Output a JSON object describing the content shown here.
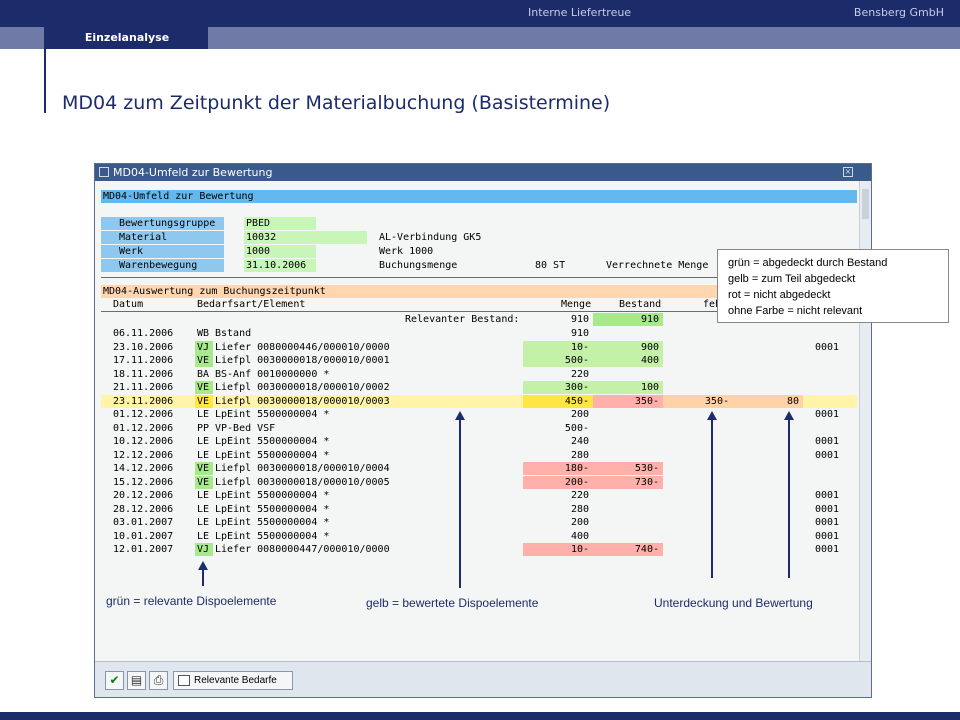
{
  "header": {
    "title": "Interne Liefertreue",
    "company": "Bensberg GmbH",
    "active_tab": "Einzelanalyse",
    "page_title": "MD04 zum Zeitpunkt der Materialbuchung (Basistermine)"
  },
  "window": {
    "title": "MD04-Umfeld zur Bewertung",
    "section1_title": "MD04-Umfeld zur Bewertung",
    "fields": [
      {
        "label": "Bewertungsgruppe",
        "value": "PBED",
        "extra": ""
      },
      {
        "label": "Material",
        "value": "10032",
        "extra": "AL-Verbindung GK5"
      },
      {
        "label": "Werk",
        "value": "1000",
        "extra": "Werk 1000"
      },
      {
        "label": "Warenbewegung",
        "value": "31.10.2006",
        "extra": "Buchungsmenge",
        "qty": "80 ST",
        "extra2": "Verrechnete Menge"
      }
    ],
    "section2_title": "MD04-Auswertung zum Buchungszeitpunkt",
    "columns": {
      "datum": "Datum",
      "element": "Bedarfsart/Element",
      "menge": "Menge",
      "bestand": "Bestand",
      "fehl": "feh"
    },
    "relevant_label": "Relevanter Bestand:",
    "relevant_menge": "910",
    "relevant_bestand": "910",
    "rows": [
      {
        "datum": "06.11.2006",
        "art": "WB",
        "element": "Bstand",
        "menge": "910",
        "bestand": "",
        "fehl": "",
        "bew": "",
        "nr": ""
      },
      {
        "datum": "23.10.2006",
        "art": "VJ",
        "element": "Liefer 0080000446/000010/0000",
        "menge": "10-",
        "bestand": "900",
        "fehl": "",
        "bew": "",
        "nr": "0001"
      },
      {
        "datum": "17.11.2006",
        "art": "VE",
        "element": "Liefpl 0030000018/000010/0001",
        "menge": "500-",
        "bestand": "400",
        "fehl": "",
        "bew": "",
        "nr": ""
      },
      {
        "datum": "18.11.2006",
        "art": "BA",
        "element": "BS-Anf 0010000000 *",
        "menge": "220",
        "bestand": "",
        "fehl": "",
        "bew": "",
        "nr": ""
      },
      {
        "datum": "21.11.2006",
        "art": "VE",
        "element": "Liefpl 0030000018/000010/0002",
        "menge": "300-",
        "bestand": "100",
        "fehl": "",
        "bew": "",
        "nr": ""
      },
      {
        "datum": "23.11.2006",
        "art": "VE",
        "element": "Liefpl 0030000018/000010/0003",
        "menge": "450-",
        "bestand": "350-",
        "fehl": "350-",
        "bew": "80",
        "nr": ""
      },
      {
        "datum": "01.12.2006",
        "art": "LE",
        "element": "LpEint 5500000004 *",
        "menge": "200",
        "bestand": "",
        "fehl": "",
        "bew": "",
        "nr": "0001"
      },
      {
        "datum": "01.12.2006",
        "art": "PP",
        "element": "VP-Bed VSF",
        "menge": "500-",
        "bestand": "",
        "fehl": "",
        "bew": "",
        "nr": ""
      },
      {
        "datum": "10.12.2006",
        "art": "LE",
        "element": "LpEint 5500000004 *",
        "menge": "240",
        "bestand": "",
        "fehl": "",
        "bew": "",
        "nr": "0001"
      },
      {
        "datum": "12.12.2006",
        "art": "LE",
        "element": "LpEint 5500000004 *",
        "menge": "280",
        "bestand": "",
        "fehl": "",
        "bew": "",
        "nr": "0001"
      },
      {
        "datum": "14.12.2006",
        "art": "VE",
        "element": "Liefpl 0030000018/000010/0004",
        "menge": "180-",
        "bestand": "530-",
        "fehl": "",
        "bew": "",
        "nr": ""
      },
      {
        "datum": "15.12.2006",
        "art": "VE",
        "element": "Liefpl 0030000018/000010/0005",
        "menge": "200-",
        "bestand": "730-",
        "fehl": "",
        "bew": "",
        "nr": ""
      },
      {
        "datum": "20.12.2006",
        "art": "LE",
        "element": "LpEint 5500000004 *",
        "menge": "220",
        "bestand": "",
        "fehl": "",
        "bew": "",
        "nr": "0001"
      },
      {
        "datum": "28.12.2006",
        "art": "LE",
        "element": "LpEint 5500000004 *",
        "menge": "280",
        "bestand": "",
        "fehl": "",
        "bew": "",
        "nr": "0001"
      },
      {
        "datum": "03.01.2007",
        "art": "LE",
        "element": "LpEint 5500000004 *",
        "menge": "200",
        "bestand": "",
        "fehl": "",
        "bew": "",
        "nr": "0001"
      },
      {
        "datum": "10.01.2007",
        "art": "LE",
        "element": "LpEint 5500000004 *",
        "menge": "400",
        "bestand": "",
        "fehl": "",
        "bew": "",
        "nr": "0001"
      },
      {
        "datum": "12.01.2007",
        "art": "VJ",
        "element": "Liefer 0080000447/000010/0000",
        "menge": "10-",
        "bestand": "740-",
        "fehl": "",
        "bew": "",
        "nr": "0001"
      }
    ],
    "toolbar": {
      "relevante_bedarfe": "Relevante Bedarfe"
    }
  },
  "legend": {
    "line1": "grün = abgedeckt durch Bestand",
    "line2": "gelb = zum Teil abgedeckt",
    "line3": "rot = nicht abgedeckt",
    "line4": "ohne Farbe = nicht relevant"
  },
  "annotations": {
    "green": "grün = relevante Dispoelemente",
    "yellow": "gelb = bewertete Dispoelemente",
    "under": "Unterdeckung und Bewertung"
  }
}
